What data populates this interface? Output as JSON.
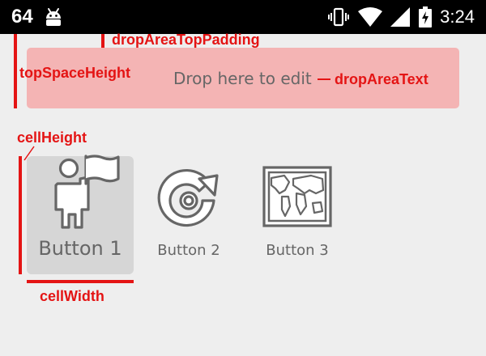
{
  "status_bar": {
    "left_number": "64",
    "time": "3:24",
    "icons": [
      "android-icon",
      "vibrate-icon",
      "wifi-icon",
      "signal-icon",
      "battery-charging-icon"
    ]
  },
  "annotations": {
    "drop_area_top_padding": "dropAreaTopPadding",
    "top_space_height": "topSpaceHeight",
    "drop_area_text_label": "dropAreaText",
    "cell_height": "cellHeight",
    "cell_width": "cellWidth",
    "annotation_color": "#e41414"
  },
  "drop_area": {
    "text": "Drop here to edit",
    "background": "#f4b4b4"
  },
  "buttons": [
    {
      "label": "Button 1",
      "icon": "person-flag-icon",
      "pressed": true
    },
    {
      "label": "Button 2",
      "icon": "refresh-icon",
      "pressed": false
    },
    {
      "label": "Button 3",
      "icon": "world-map-icon",
      "pressed": false
    }
  ]
}
